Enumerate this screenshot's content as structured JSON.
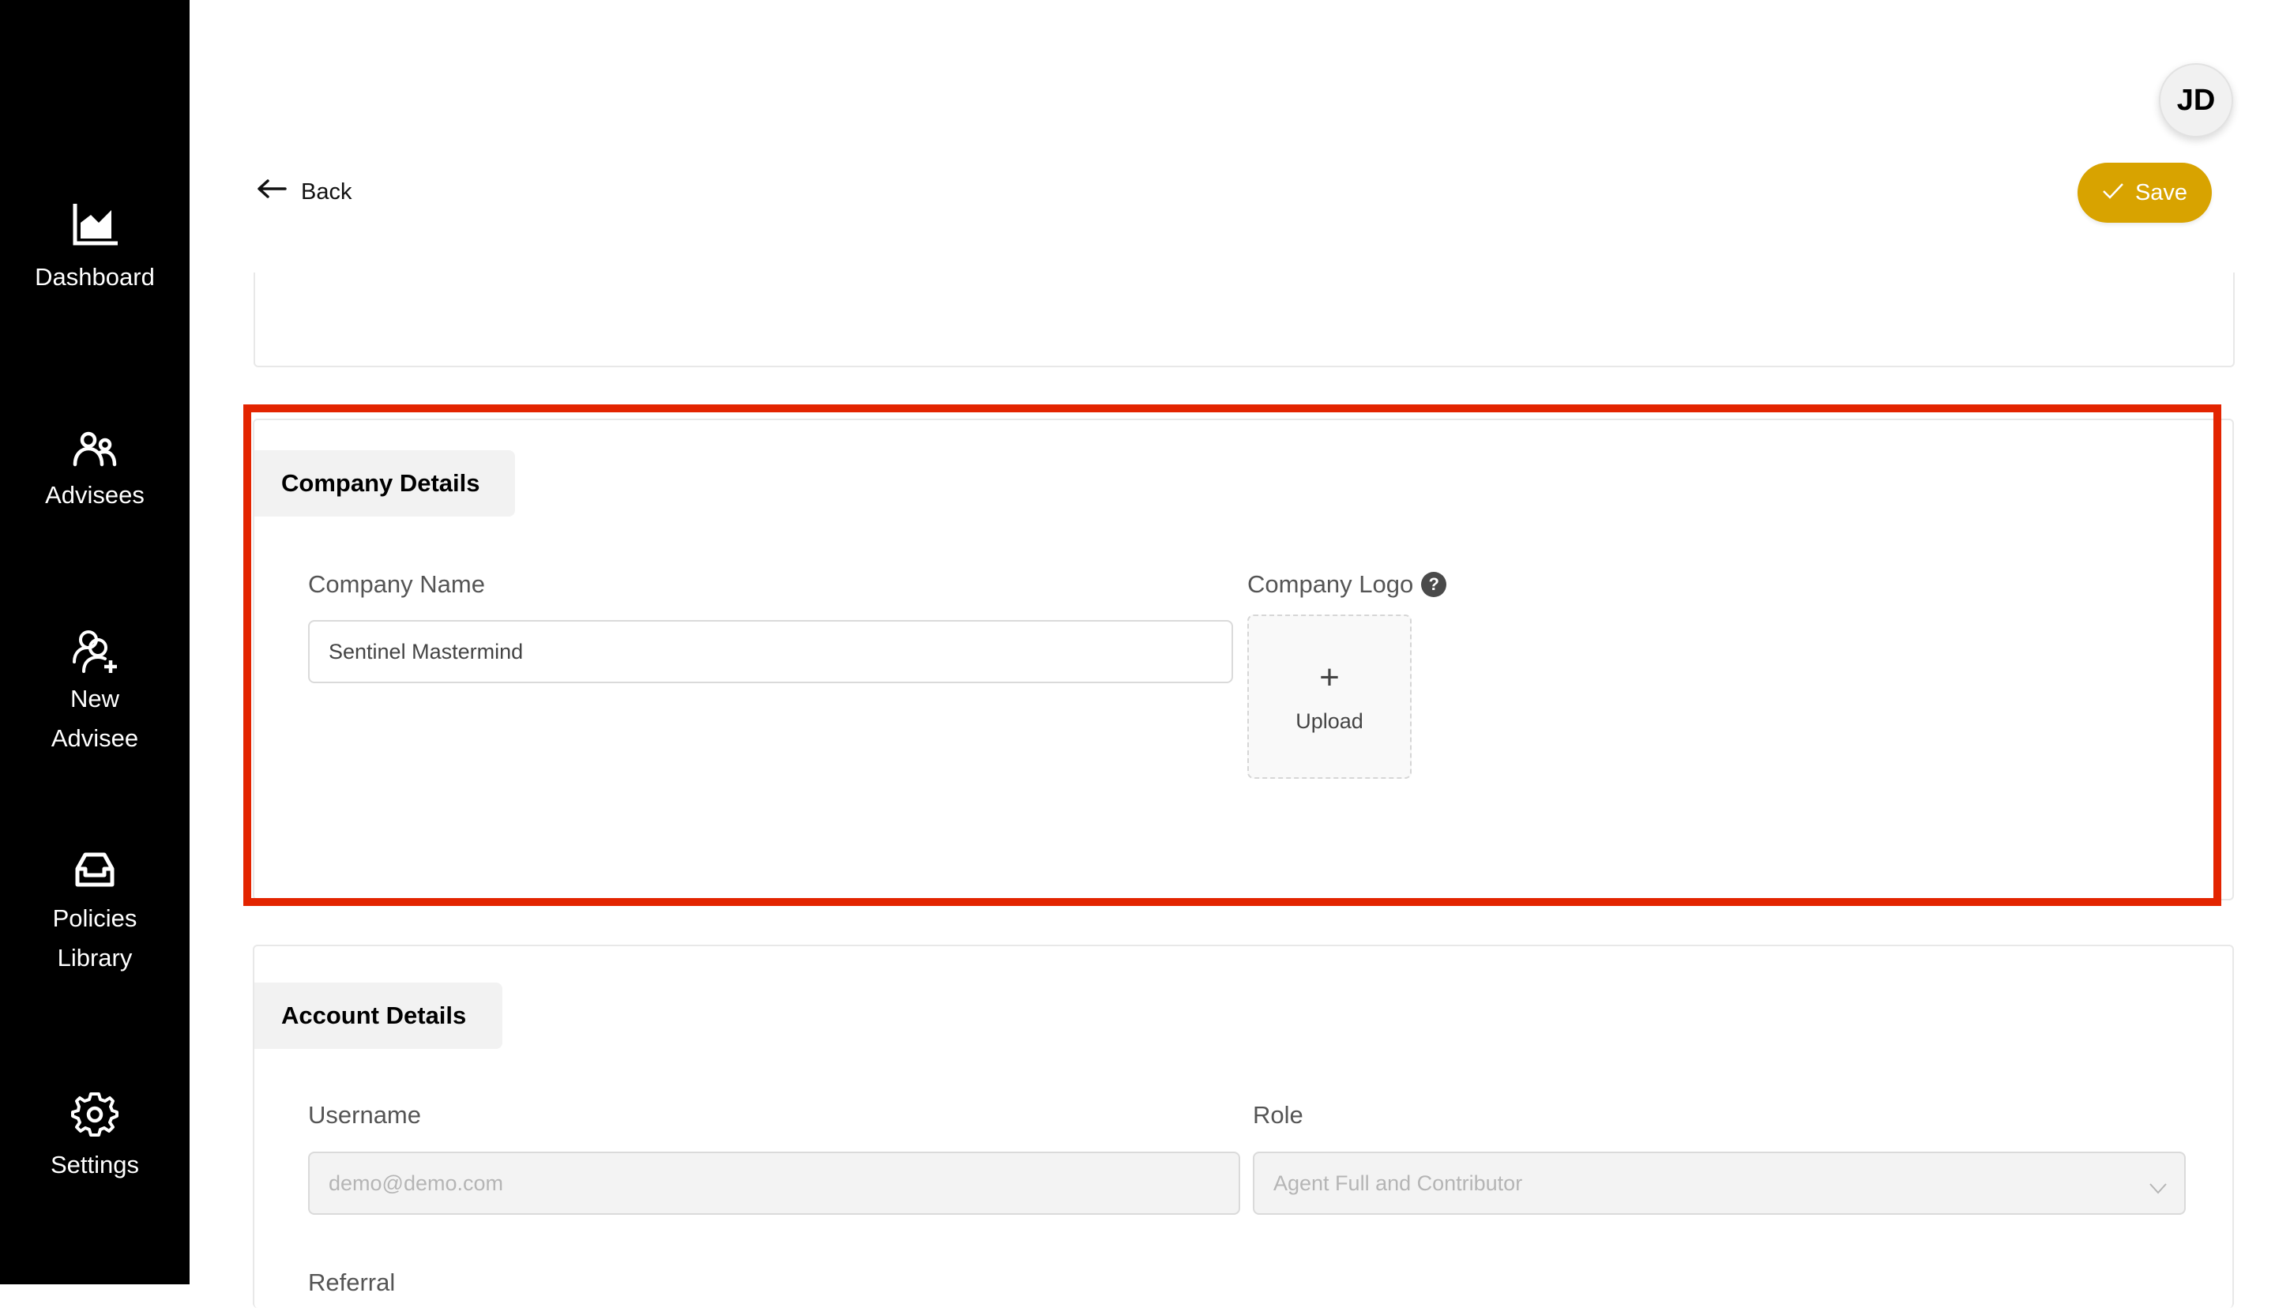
{
  "sidebar": {
    "items": [
      {
        "label": "Dashboard",
        "icon": "chart-area-icon"
      },
      {
        "label": "Advisees",
        "icon": "users-icon"
      },
      {
        "label": "New\nAdvisee",
        "label_line1": "New",
        "label_line2": "Advisee",
        "icon": "user-add-icon"
      },
      {
        "label": "Policies\nLibrary",
        "label_line1": "Policies",
        "label_line2": "Library",
        "icon": "inbox-icon"
      },
      {
        "label": "Settings",
        "icon": "gear-icon"
      }
    ]
  },
  "header": {
    "avatar_initials": "JD",
    "back_label": "Back",
    "save_label": "Save"
  },
  "colors": {
    "sidebar_bg": "#000000",
    "save_button": "#d8a300",
    "highlight_border": "#e32400"
  },
  "company_details": {
    "title": "Company Details",
    "company_name_label": "Company Name",
    "company_name_value": "Sentinel Mastermind",
    "company_logo_label": "Company Logo",
    "help_icon_glyph": "?",
    "upload_plus": "+",
    "upload_label": "Upload"
  },
  "account_details": {
    "title": "Account Details",
    "username_label": "Username",
    "username_value": "demo@demo.com",
    "role_label": "Role",
    "role_value": "Agent Full and Contributor",
    "referral_label": "Referral"
  }
}
